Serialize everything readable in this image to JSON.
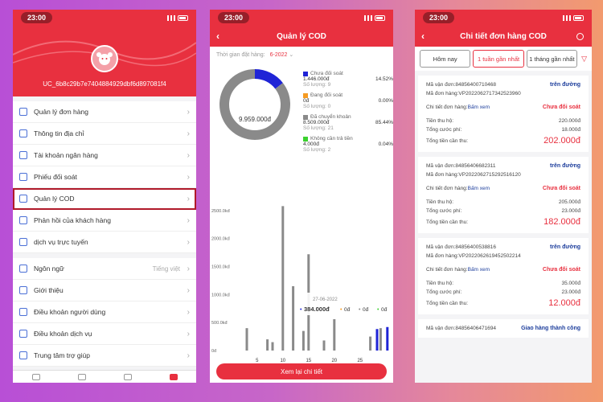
{
  "status_time": "23:00",
  "phone1": {
    "user_id": "UC_6b8c29b7e7404884929dbf6d897081f4",
    "menu1": [
      {
        "label": "Quản lý đơn hàng",
        "icon": "orders-icon"
      },
      {
        "label": "Thông tin địa chỉ",
        "icon": "location-icon"
      },
      {
        "label": "Tài khoản ngân hàng",
        "icon": "bank-icon"
      },
      {
        "label": "Phiếu đối soát",
        "icon": "receipt-icon"
      },
      {
        "label": "Quản lý COD",
        "icon": "cod-icon"
      },
      {
        "label": "Phản hồi của khách hàng",
        "icon": "feedback-icon"
      },
      {
        "label": "dịch vụ trực tuyến",
        "icon": "service-icon"
      }
    ],
    "menu2": [
      {
        "label": "Ngôn ngữ",
        "value": "Tiếng việt",
        "icon": "language-icon"
      },
      {
        "label": "Giới thiệu",
        "icon": "info-icon"
      },
      {
        "label": "Điều khoản người dùng",
        "icon": "link-icon"
      },
      {
        "label": "Điều khoản dịch vụ",
        "icon": "link-icon"
      },
      {
        "label": "Trung tâm trợ giúp",
        "icon": "help-icon"
      }
    ]
  },
  "phone2": {
    "title": "Quản lý COD",
    "filter_label": "Thời gian đặt hàng:",
    "filter_value": "6-2022",
    "total": "9.959.000đ",
    "legend": [
      {
        "name": "Chưa đối soát",
        "amount": "1.446.000đ",
        "pct": "14.52%",
        "count": "Số lượng: 9",
        "color": "#1f24d6"
      },
      {
        "name": "Đang đối soát",
        "amount": "0đ",
        "pct": "0.00%",
        "count": "Số lượng: 0",
        "color": "#f59b23"
      },
      {
        "name": "Đã chuyển khoản",
        "amount": "8.509.000đ",
        "pct": "85.44%",
        "count": "Số lượng: 21",
        "color": "#8a8a8a"
      },
      {
        "name": "Không cần trả tiền",
        "amount": "4.000đ",
        "pct": "0.04%",
        "count": "Số lượng: 2",
        "color": "#3bd12f"
      }
    ],
    "button": "Xem lại chi tiết"
  },
  "chart_data": {
    "type": "bar",
    "y_ticks": [
      "2500.0kđ",
      "2000.0kđ",
      "1500.0kđ",
      "1000.0kđ",
      "500.0kđ",
      "0đ"
    ],
    "x_ticks": [
      "5",
      "10",
      "15",
      "20",
      "25"
    ],
    "ylim": [
      0,
      2700
    ],
    "x": [
      1,
      2,
      3,
      4,
      5,
      6,
      7,
      8,
      9,
      10,
      11,
      12,
      13,
      14,
      15,
      16,
      17,
      18,
      19,
      20,
      21,
      22,
      23,
      24,
      25,
      26,
      27,
      28,
      29,
      30
    ],
    "series": [
      {
        "name": "Đã chuyển khoản",
        "color": "#8a8a8a",
        "values": [
          0,
          0,
          400,
          0,
          0,
          0,
          200,
          150,
          0,
          2580,
          0,
          1150,
          0,
          350,
          1720,
          0,
          0,
          180,
          0,
          560,
          0,
          0,
          0,
          0,
          0,
          0,
          250,
          0,
          400,
          0
        ]
      },
      {
        "name": "Chưa đối soát",
        "color": "#1f24d6",
        "values": [
          0,
          0,
          0,
          0,
          0,
          0,
          0,
          0,
          0,
          0,
          0,
          0,
          0,
          0,
          0,
          0,
          0,
          0,
          0,
          0,
          0,
          0,
          0,
          0,
          0,
          0,
          0,
          384,
          0,
          420
        ]
      }
    ],
    "tooltip": {
      "date": "27-06-2022",
      "items": [
        "384.000đ",
        "0đ",
        "0đ",
        "0đ"
      ],
      "colors": [
        "#1f24d6",
        "#f59b23",
        "#8a8a8a",
        "#3bd12f"
      ]
    }
  },
  "phone3": {
    "title": "Chi tiết đơn hàng COD",
    "tabs": [
      "Hôm nay",
      "1 tuần gần nhất",
      "1 tháng gần nhất"
    ],
    "cards": [
      {
        "van_don": "Mã vận đơn:84856400710468",
        "status1": "trên đường",
        "don_hang": "Mã đơn hàng:VP2022062717342523960",
        "chi_tiet": "Chi tiết đơn hàng:",
        "xem": "Bấm xem",
        "status2": "Chưa đối soát",
        "thu_ho_l": "Tiền thu hộ:",
        "thu_ho": "220.000đ",
        "cuoc_l": "Tổng cước phí:",
        "cuoc": "18.000đ",
        "can_thu_l": "Tổng tiền cần thu:",
        "can_thu": "202.000đ"
      },
      {
        "van_don": "Mã vận đơn:84856406682311",
        "status1": "trên đường",
        "don_hang": "Mã đơn hàng:VP2022062715292516120",
        "chi_tiet": "Chi tiết đơn hàng:",
        "xem": "Bấm xem",
        "status2": "Chưa đối soát",
        "thu_ho_l": "Tiền thu hộ:",
        "thu_ho": "205.000đ",
        "cuoc_l": "Tổng cước phí:",
        "cuoc": "23.000đ",
        "can_thu_l": "Tổng tiền cần thu:",
        "can_thu": "182.000đ"
      },
      {
        "van_don": "Mã vận đơn:84856400538816",
        "status1": "trên đường",
        "don_hang": "Mã đơn hàng:VP2022062619452502214",
        "chi_tiet": "Chi tiết đơn hàng:",
        "xem": "Bấm xem",
        "status2": "Chưa đối soát",
        "thu_ho_l": "Tiền thu hộ:",
        "thu_ho": "35.000đ",
        "cuoc_l": "Tổng cước phí:",
        "cuoc": "23.000đ",
        "can_thu_l": "Tổng tiền cần thu:",
        "can_thu": "12.000đ"
      }
    ],
    "partial": {
      "van_don": "Mã vận đơn:84856406471694",
      "status1": "Giao hàng thành công"
    }
  }
}
